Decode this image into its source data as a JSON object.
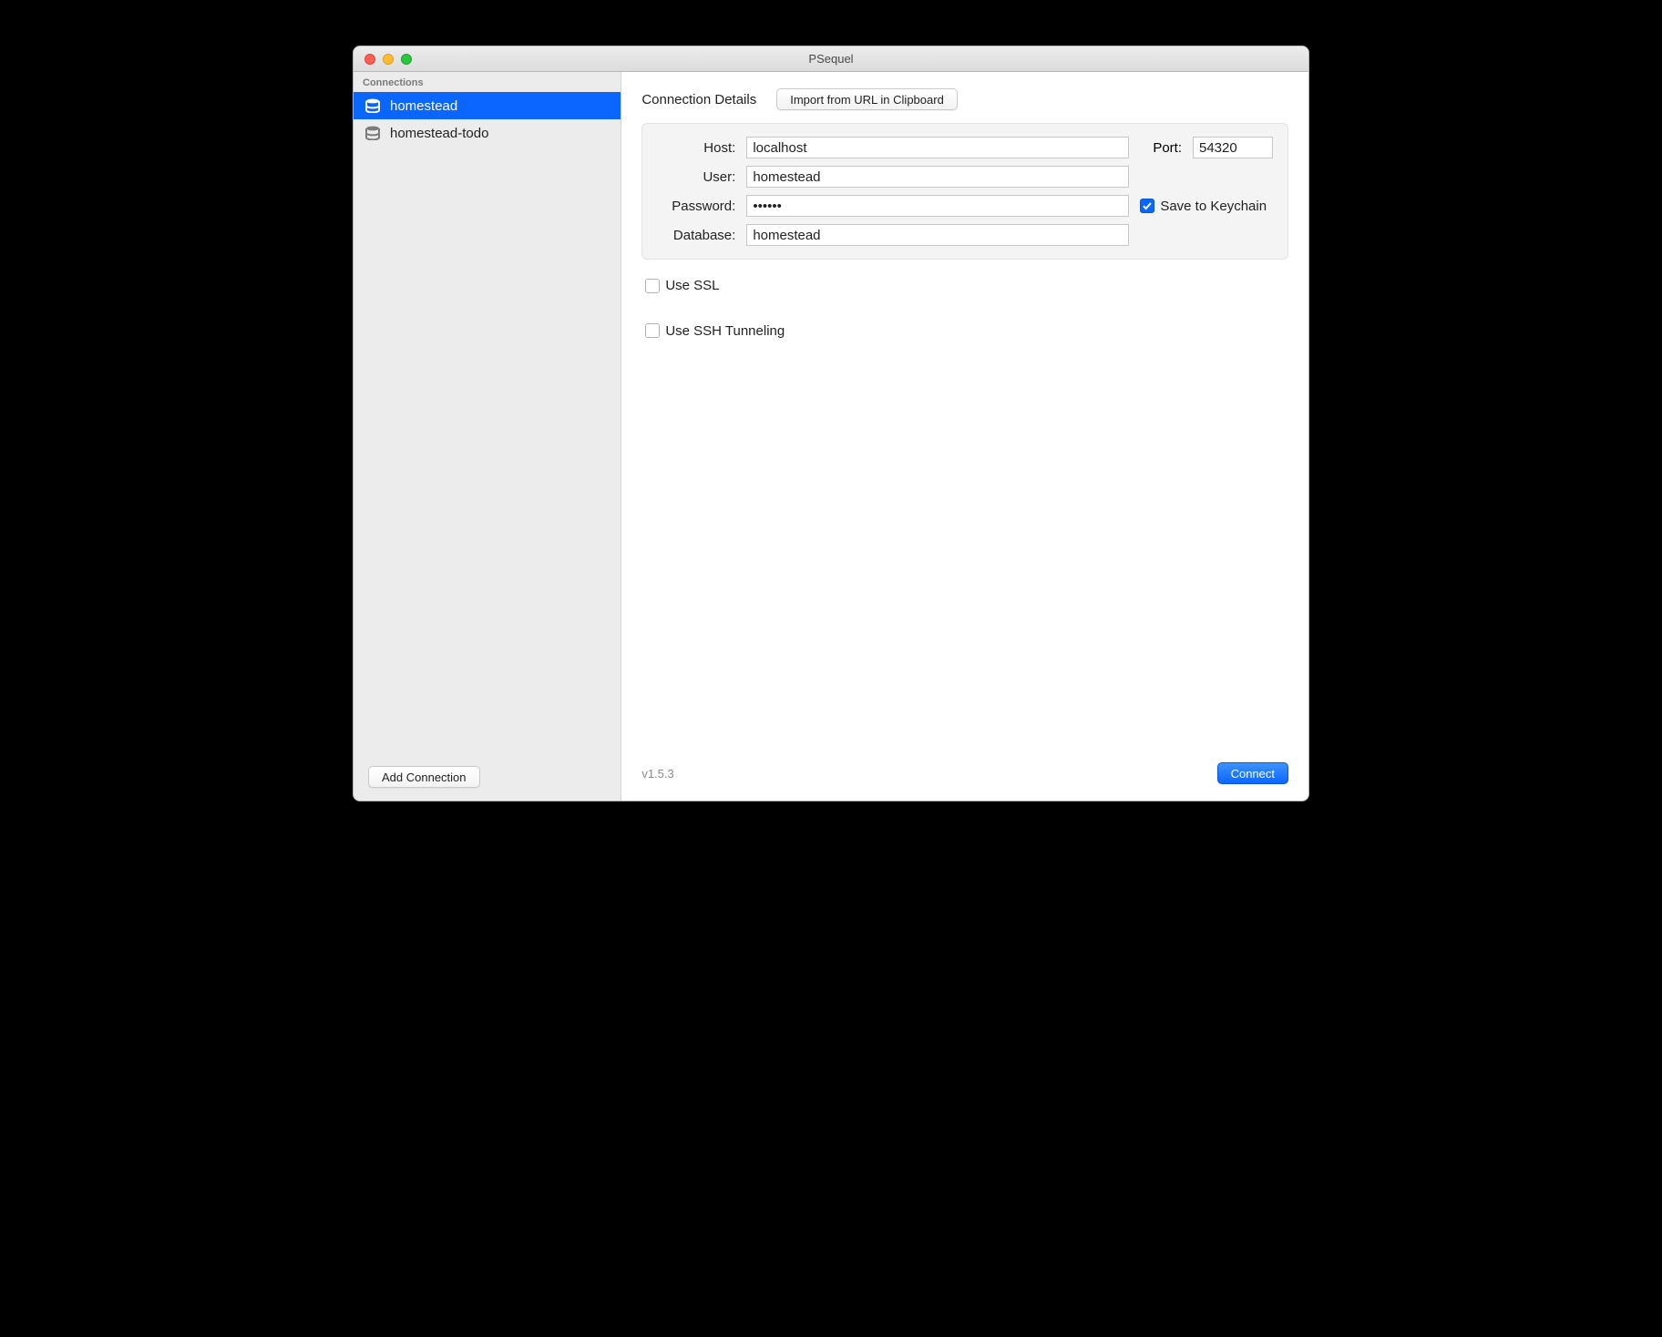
{
  "window": {
    "title": "PSequel"
  },
  "sidebar": {
    "header": "Connections",
    "items": [
      {
        "label": "homestead",
        "selected": true
      },
      {
        "label": "homestead-todo",
        "selected": false
      }
    ],
    "addButton": "Add Connection"
  },
  "details": {
    "title": "Connection Details",
    "importButton": "Import from URL in Clipboard",
    "labels": {
      "host": "Host:",
      "port": "Port:",
      "user": "User:",
      "password": "Password:",
      "database": "Database:",
      "saveKeychain": "Save to Keychain",
      "useSSL": "Use SSL",
      "useSSH": "Use SSH Tunneling"
    },
    "values": {
      "host": "localhost",
      "port": "54320",
      "user": "homestead",
      "password": "••••••",
      "database": "homestead",
      "saveKeychain": true,
      "useSSL": false,
      "useSSH": false
    }
  },
  "footer": {
    "version": "v1.5.3",
    "connect": "Connect"
  }
}
